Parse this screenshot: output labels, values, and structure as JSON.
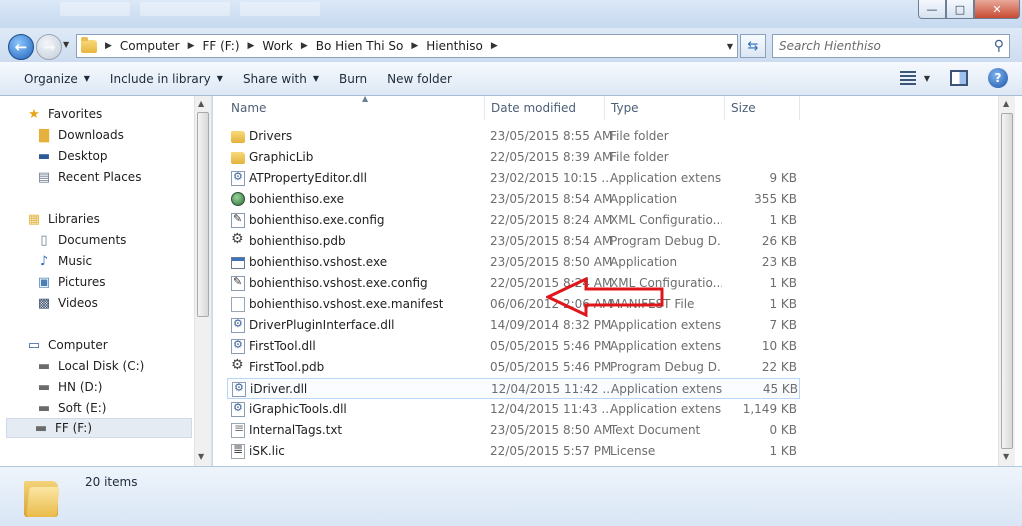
{
  "window": {
    "ghost_tabs": [
      "",
      "",
      "",
      "",
      ""
    ],
    "controls": {
      "minimize": "—",
      "maximize": "□",
      "close": "✕"
    }
  },
  "address": {
    "crumbs": [
      "Computer",
      "FF (F:)",
      "Work",
      "Bo Hien Thi So",
      "Hienthiso"
    ],
    "search_placeholder": "Search Hienthiso"
  },
  "toolbar": {
    "organize": "Organize",
    "include_in_library": "Include in library",
    "share_with": "Share with",
    "burn": "Burn",
    "new_folder": "New folder"
  },
  "nav": {
    "favorites": "Favorites",
    "downloads": "Downloads",
    "desktop": "Desktop",
    "recent_places": "Recent Places",
    "libraries": "Libraries",
    "documents": "Documents",
    "music": "Music",
    "pictures": "Pictures",
    "videos": "Videos",
    "computer": "Computer",
    "local_disk": "Local Disk (C:)",
    "hn": "HN (D:)",
    "soft": "Soft (E:)",
    "ff": "FF (F:)"
  },
  "columns": {
    "name": "Name",
    "date": "Date modified",
    "type": "Type",
    "size": "Size"
  },
  "files": [
    {
      "name": "Drivers",
      "date": "23/05/2015 8:55 AM",
      "type": "File folder",
      "size": "",
      "icon": "folder-icon"
    },
    {
      "name": "GraphicLib",
      "date": "22/05/2015 8:39 AM",
      "type": "File folder",
      "size": "",
      "icon": "folder-icon"
    },
    {
      "name": "ATPropertyEditor.dll",
      "date": "23/02/2015 10:15 ...",
      "type": "Application extens...",
      "size": "9 KB",
      "icon": "dll-icon"
    },
    {
      "name": "bohienthiso.exe",
      "date": "23/05/2015 8:54 AM",
      "type": "Application",
      "size": "355 KB",
      "icon": "exe-icon"
    },
    {
      "name": "bohienthiso.exe.config",
      "date": "22/05/2015 8:24 AM",
      "type": "XML Configuratio...",
      "size": "1 KB",
      "icon": "config-icon"
    },
    {
      "name": "bohienthiso.pdb",
      "date": "23/05/2015 8:54 AM",
      "type": "Program Debug D...",
      "size": "26 KB",
      "icon": "pdb-icon"
    },
    {
      "name": "bohienthiso.vshost.exe",
      "date": "23/05/2015 8:50 AM",
      "type": "Application",
      "size": "23 KB",
      "icon": "app-icon"
    },
    {
      "name": "bohienthiso.vshost.exe.config",
      "date": "22/05/2015 8:24 AM",
      "type": "XML Configuratio...",
      "size": "1 KB",
      "icon": "config-icon"
    },
    {
      "name": "bohienthiso.vshost.exe.manifest",
      "date": "06/06/2012 2:06 AM",
      "type": "MANIFEST File",
      "size": "1 KB",
      "icon": "document-icon"
    },
    {
      "name": "DriverPluginInterface.dll",
      "date": "14/09/2014 8:32 PM",
      "type": "Application extens...",
      "size": "7 KB",
      "icon": "dll-icon"
    },
    {
      "name": "FirstTool.dll",
      "date": "05/05/2015 5:46 PM",
      "type": "Application extens...",
      "size": "10 KB",
      "icon": "dll-icon"
    },
    {
      "name": "FirstTool.pdb",
      "date": "05/05/2015 5:46 PM",
      "type": "Program Debug D...",
      "size": "22 KB",
      "icon": "pdb-icon"
    },
    {
      "name": "iDriver.dll",
      "date": "12/04/2015 11:42 ...",
      "type": "Application extens...",
      "size": "45 KB",
      "icon": "dll-icon"
    },
    {
      "name": "iGraphicTools.dll",
      "date": "12/04/2015 11:43 ...",
      "type": "Application extens...",
      "size": "1,149 KB",
      "icon": "dll-icon"
    },
    {
      "name": "InternalTags.txt",
      "date": "23/05/2015 8:50 AM",
      "type": "Text Document",
      "size": "0 KB",
      "icon": "text-file-icon"
    },
    {
      "name": "iSK.lic",
      "date": "22/05/2015 5:57 PM",
      "type": "License",
      "size": "1 KB",
      "icon": "license-icon"
    }
  ],
  "status": {
    "item_count": "20 items"
  },
  "colors": {
    "annotation_arrow": "#e0161b",
    "hover_border": "#b8d6f5"
  }
}
